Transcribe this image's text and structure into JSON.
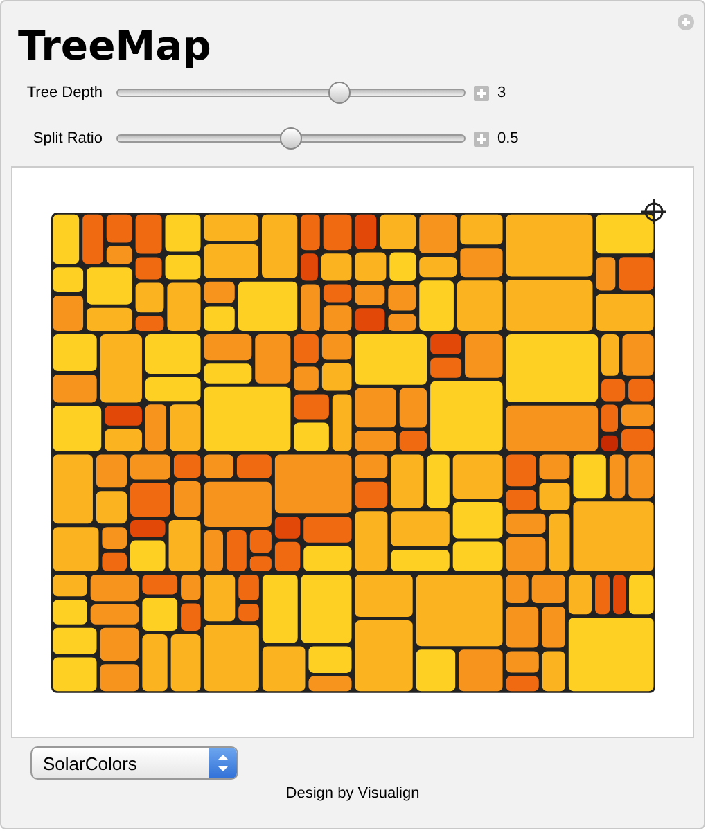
{
  "title": "TreeMap",
  "controls": [
    {
      "label": "Tree Depth",
      "level": 0.65,
      "value": "3"
    },
    {
      "label": "Split Ratio",
      "level": 0.5,
      "value": "0.5"
    }
  ],
  "color_scheme": {
    "value": "SolarColors"
  },
  "footer": "Design by Visualign"
}
